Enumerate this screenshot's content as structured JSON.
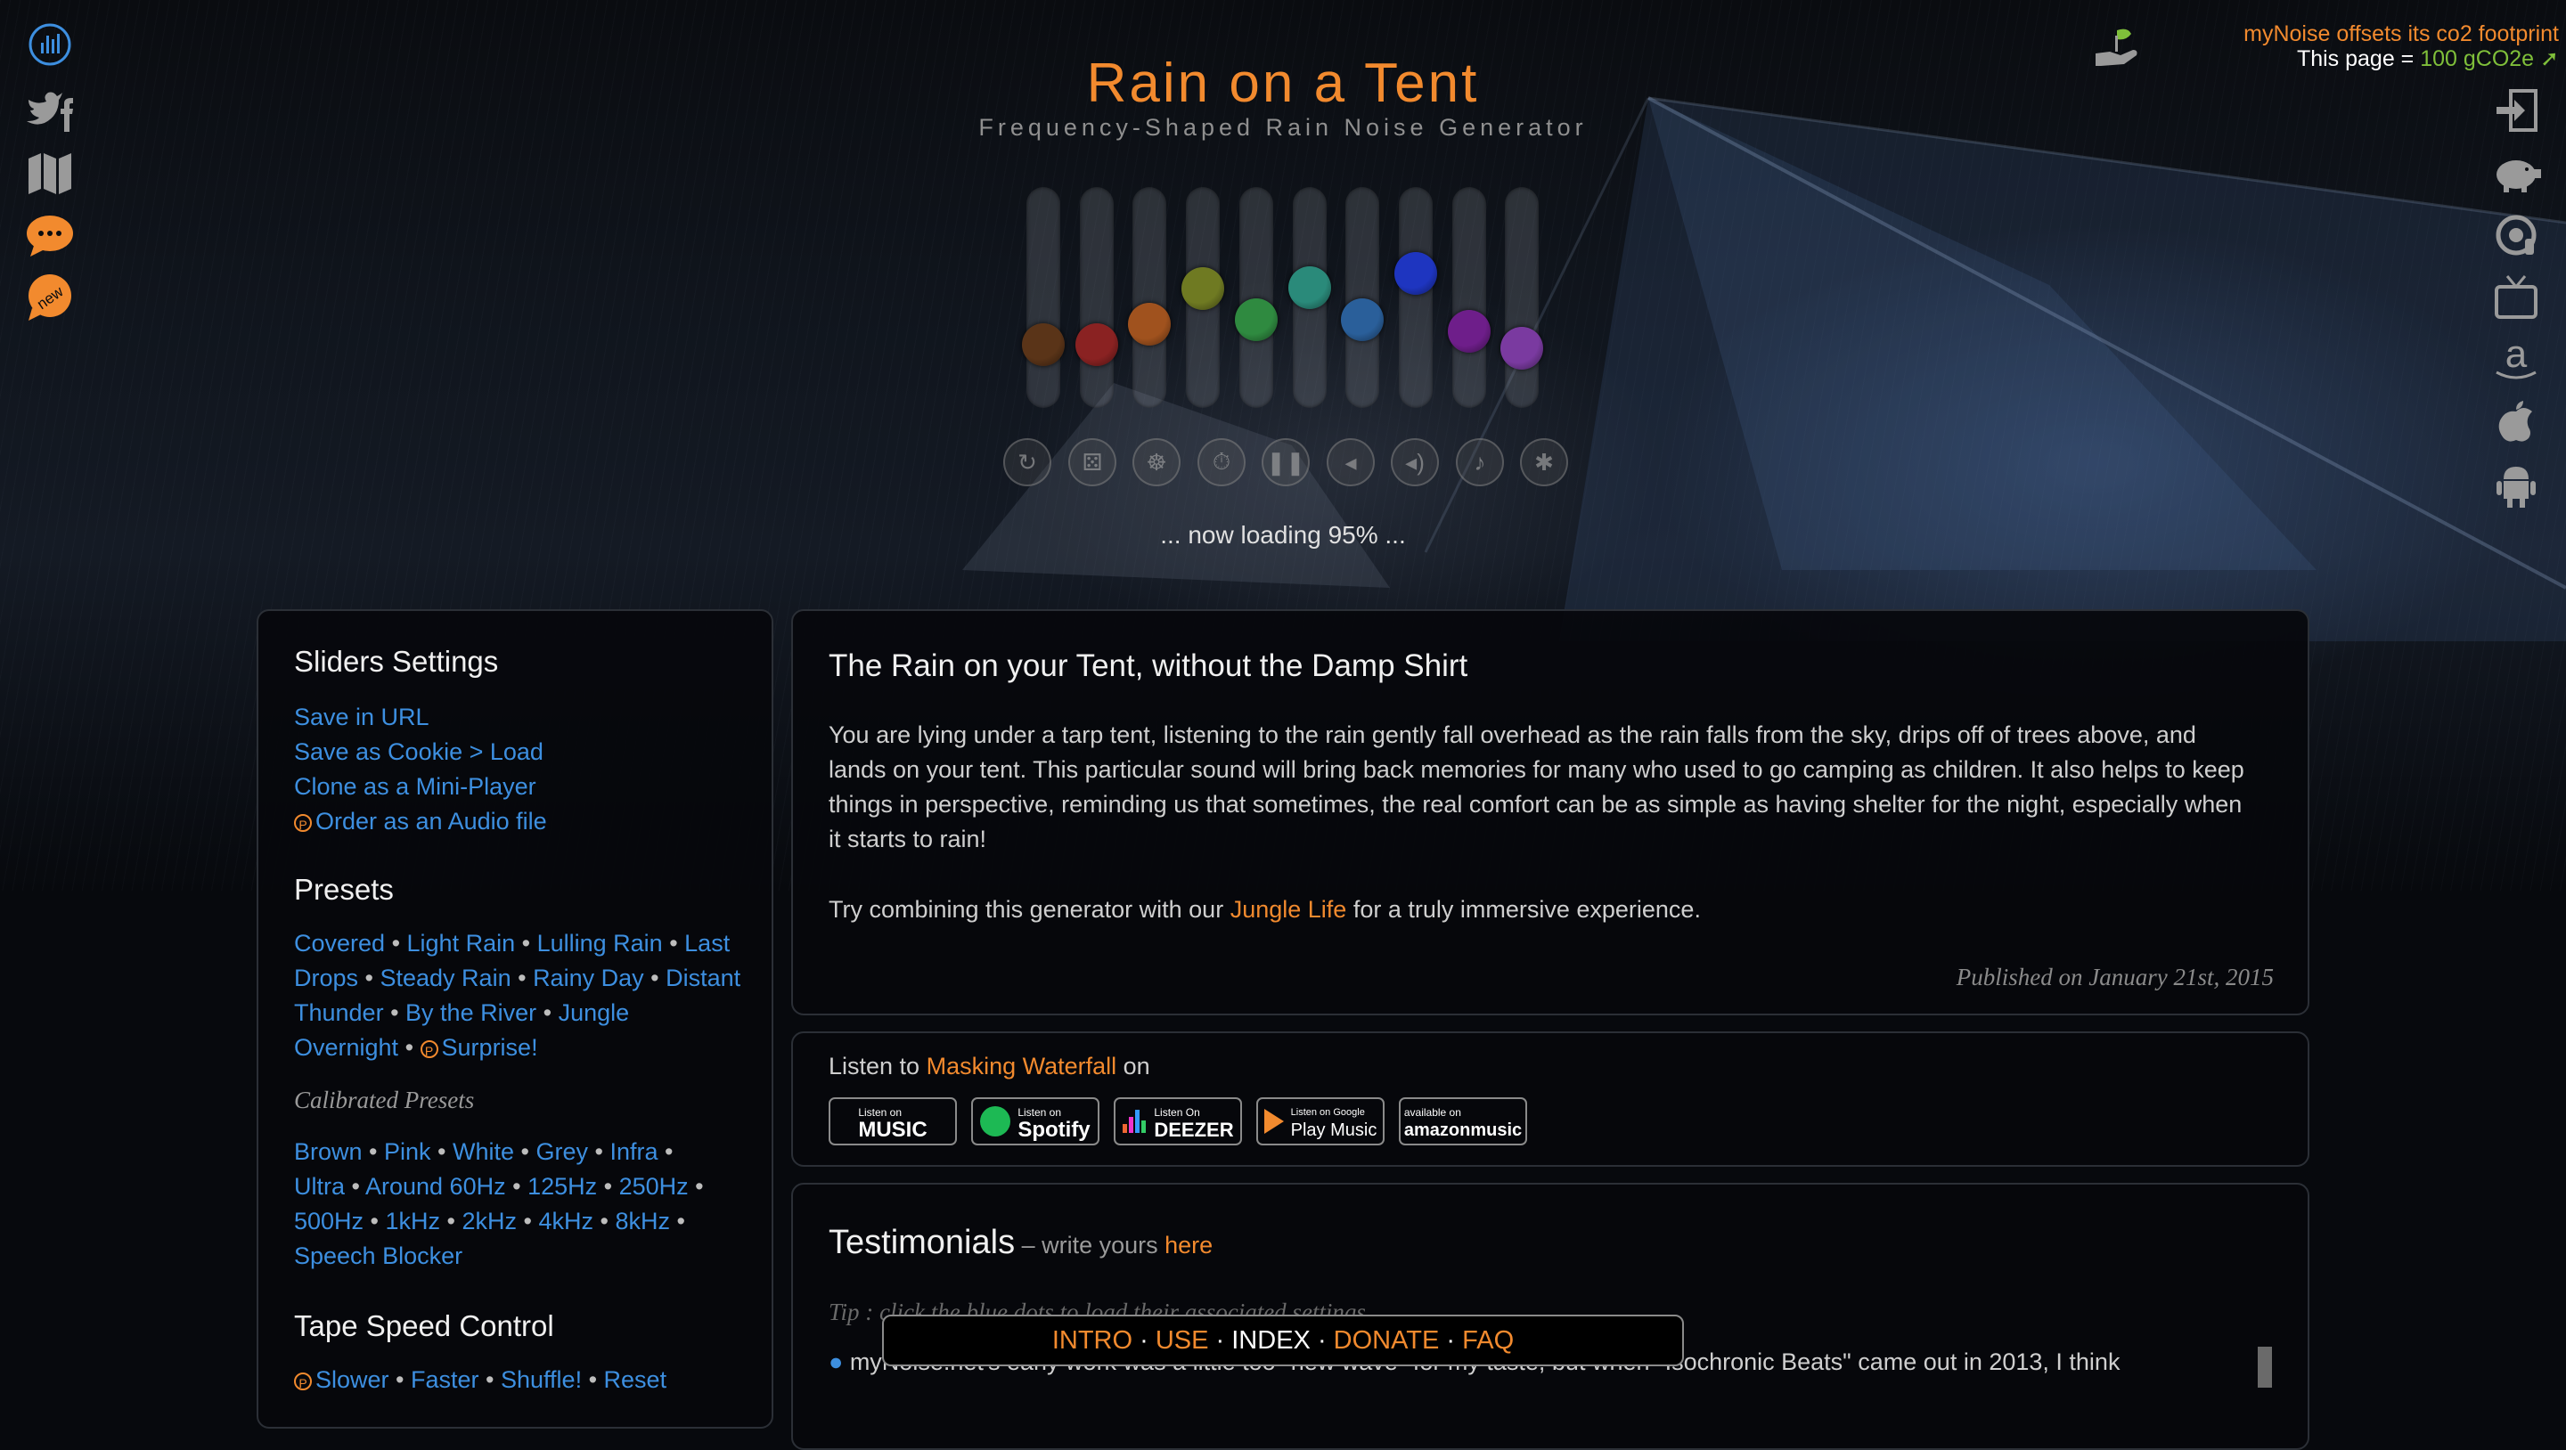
{
  "header": {
    "title": "Rain on a Tent",
    "subtitle": "Frequency-Shaped Rain Noise Generator",
    "loading": "... now loading 95% ..."
  },
  "co2": {
    "line1": "myNoise offsets its co2 footprint",
    "line2_prefix": "This page = ",
    "line2_value": "100 gCO2e"
  },
  "left_icons": [
    "equalizer-icon",
    "twitter-facebook-icon",
    "map-icon",
    "chat-icon",
    "new-badge-icon"
  ],
  "new_badge": "new",
  "right_icons": [
    "login-icon",
    "piggy-bank-icon",
    "headphones-icon",
    "tv-icon",
    "amazon-icon",
    "apple-icon",
    "android-icon"
  ],
  "sliders": {
    "levels": [
      0.22,
      0.22,
      0.34,
      0.55,
      0.37,
      0.56,
      0.37,
      0.64,
      0.3,
      0.2
    ],
    "colors": [
      "#5a3418",
      "#8a2222",
      "#a0521e",
      "#6f7a22",
      "#2f8a40",
      "#2a8a7a",
      "#2a5f9a",
      "#1e35c0",
      "#6e1e8a",
      "#7a3aa0"
    ]
  },
  "controls": [
    "reset-icon",
    "random-icon",
    "animate-icon",
    "timer-icon",
    "pause-icon",
    "volume-down-icon",
    "volume-up-icon",
    "alarm-icon",
    "settings-icon"
  ],
  "left_panel": {
    "sliders_settings": {
      "title": "Sliders Settings",
      "links": [
        "Save in URL",
        "Save as Cookie > Load",
        "Clone as a Mini-Player",
        "Order as an Audio file"
      ]
    },
    "presets": {
      "title": "Presets",
      "line1": [
        "Covered",
        "Light Rain",
        "Lulling Rain",
        "Last"
      ],
      "line2": [
        "Drops",
        "Steady Rain",
        "Rainy Day",
        "Distant"
      ],
      "line3": [
        "Thunder",
        "By the River",
        "Jungle"
      ],
      "line4": [
        "Overnight",
        "Surprise!"
      ]
    },
    "calibrated": {
      "title": "Calibrated Presets",
      "line1": [
        "Brown",
        "Pink",
        "White",
        "Grey",
        "Infra"
      ],
      "line2": [
        "Ultra",
        "Around 60Hz",
        "125Hz",
        "250Hz"
      ],
      "line3": [
        "500Hz",
        "1kHz",
        "2kHz",
        "4kHz",
        "8kHz"
      ],
      "line4": [
        "Speech Blocker"
      ]
    },
    "tape": {
      "title": "Tape Speed Control",
      "links": [
        "Slower",
        "Faster",
        "Shuffle!",
        "Reset"
      ]
    }
  },
  "description": {
    "title": "The Rain on your Tent, without the Damp Shirt",
    "lines": [
      "You are lying under a tarp tent, listening to the rain gently fall overhead as the rain falls from the sky, drips off of trees above, and",
      "lands on your tent. This particular sound will bring back memories for many who used to go camping as children. It also helps to keep",
      "things in perspective, reminding us that sometimes, the real comfort can be as simple as having shelter for the night, especially when",
      "it starts to rain!"
    ],
    "combo_prefix": "Try combining this generator with our ",
    "combo_link": "Jungle Life",
    "combo_suffix": " for a truly immersive experience.",
    "published": "Published on January 21st, 2015"
  },
  "listen": {
    "prefix": "Listen to ",
    "link": "Masking Waterfall",
    "suffix": " on",
    "badges": [
      {
        "small": "Listen on",
        "big": "MUSIC"
      },
      {
        "small": "Listen on",
        "big": "Spotify"
      },
      {
        "small": "Listen On",
        "big": "DEEZER"
      },
      {
        "small": "Listen on Google",
        "big": "Play Music"
      },
      {
        "small": "available on",
        "big": "amazonmusic"
      }
    ]
  },
  "testimonials": {
    "title": "Testimonials",
    "sub_prefix": " – write yours ",
    "sub_link": "here",
    "tip": "Tip : click the blue dots to load their associated settings",
    "first": "myNoise.net's early work was a little too \"new wave\" for my taste, but when \"Isochronic Beats\" came out in 2013, I think"
  },
  "bottom_nav": [
    "INTRO",
    "USE",
    "INDEX",
    "DONATE",
    "FAQ"
  ]
}
